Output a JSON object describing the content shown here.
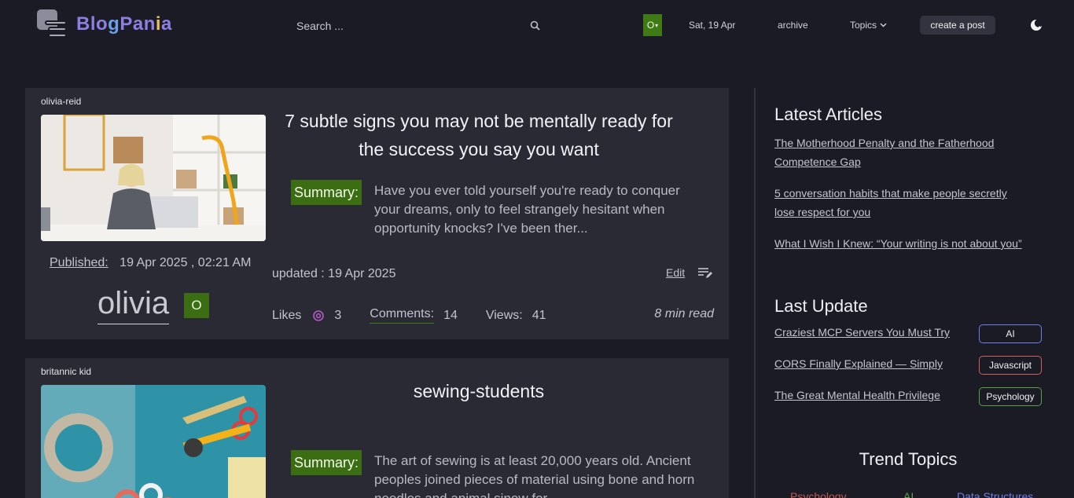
{
  "header": {
    "logo_text_parts": [
      "Bl",
      "o",
      "g",
      "Pan",
      "i",
      "a"
    ],
    "search_placeholder": "Search ...",
    "user_initial": "O",
    "date": "Sat, 19 Apr",
    "archive_label": "archive",
    "topics_label": "Topics",
    "create_label": "create a post"
  },
  "posts": [
    {
      "author": "olivia-reid",
      "title": "7 subtle signs you may not be mentally ready for the success you say you want",
      "summary_label": "Summary:",
      "summary": "Have you ever told yourself you're ready to conquer your dreams, only to feel strangely hesitant when opportunity knocks? I've been ther...",
      "published_label": "Published:",
      "published_value": "19 Apr 2025 , 02:21 AM",
      "author_name": "olivia",
      "author_initial": "O",
      "updated": "updated : 19 Apr 2025",
      "edit_label": "Edit",
      "likes_label": "Likes",
      "likes": "3",
      "comments_label": "Comments:",
      "comments": "14",
      "views_label": "Views:",
      "views": "41",
      "read_time": "8 min read"
    },
    {
      "author": "britannic kid",
      "title": "sewing-students",
      "summary_label": "Summary:",
      "summary": "The art of sewing is at least 20,000 years old. Ancient peoples joined pieces of material using bone and horn needles and animal sinew for..."
    }
  ],
  "sidebar": {
    "latest_heading": "Latest Articles",
    "latest": [
      "The Motherhood Penalty and the Fatherhood Competence Gap",
      "5 conversation habits that make people secretly lose respect for you",
      "What I Wish I Knew: “Your writing is not about you”"
    ],
    "update_heading": "Last Update",
    "updates": [
      {
        "title": "Craziest MCP Servers You Must Try",
        "tag": "AI",
        "color": "#6f7fe6"
      },
      {
        "title": "CORS Finally Explained — Simply",
        "tag": "Javascript",
        "color": "#d0605a"
      },
      {
        "title": "The Great Mental Health Privilege",
        "tag": "Psychology",
        "color": "#5ea04a"
      }
    ],
    "trend_heading": "Trend Topics",
    "trends": [
      {
        "label": "Psychology",
        "color": "#c0584f"
      },
      {
        "label": "AI",
        "color": "#5ea04a"
      },
      {
        "label": "Data Structures",
        "color": "#6f7fe6"
      }
    ]
  }
}
